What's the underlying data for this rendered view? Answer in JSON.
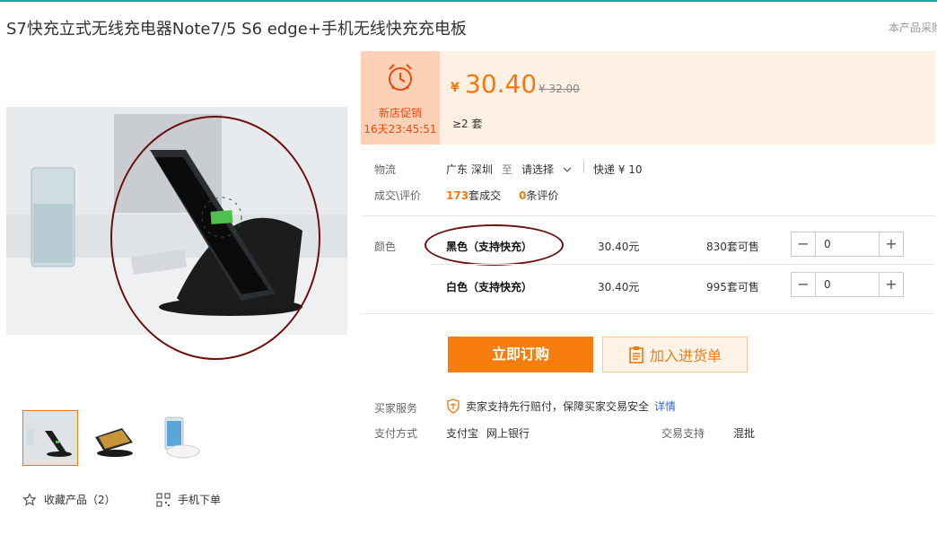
{
  "product": {
    "title": "S7快充立式无线充电器Note7/5 S6 edge+手机无线快充充电板",
    "title_right": "本产品采购"
  },
  "promo": {
    "label": "新店促销",
    "timer": "16天23:45:51",
    "icon": "alarm-clock-icon"
  },
  "price": {
    "currency": "¥",
    "current": "30.40",
    "original": "¥ 32.00",
    "min_order": "≥2 套"
  },
  "logistics": {
    "label": "物流",
    "from": "广东 深圳",
    "to_word": "至",
    "destination": "请选择",
    "express": "快递 ¥ 10"
  },
  "deals": {
    "label": "成交\\评价",
    "sold_count": "173",
    "sold_unit": "套成交",
    "review_count": "0",
    "review_unit": "条评价"
  },
  "variants": {
    "label": "颜色",
    "items": [
      {
        "name": "黑色（支持快充）",
        "price": "30.40元",
        "stock": "830套可售",
        "qty": "0"
      },
      {
        "name": "白色（支持快充）",
        "price": "30.40元",
        "stock": "995套可售",
        "qty": "0"
      }
    ]
  },
  "actions": {
    "buy_now": "立即订购",
    "add_to_cart": "加入进货单"
  },
  "service": {
    "label": "买家服务",
    "text": "卖家支持先行赔付，保障买家交易安全",
    "link": "详情"
  },
  "payment": {
    "label": "支付方式",
    "methods": [
      "支付宝",
      "网上银行"
    ],
    "trade_label": "交易支持",
    "trade_value": "混批"
  },
  "footer": {
    "favorite": "收藏产品（2）",
    "mobile": "手机下单"
  },
  "colors": {
    "accent": "#f07a13",
    "promo_bg": "#fcd1b5",
    "price_bg": "#fff0e4",
    "annotation": "#6b0f0f"
  }
}
